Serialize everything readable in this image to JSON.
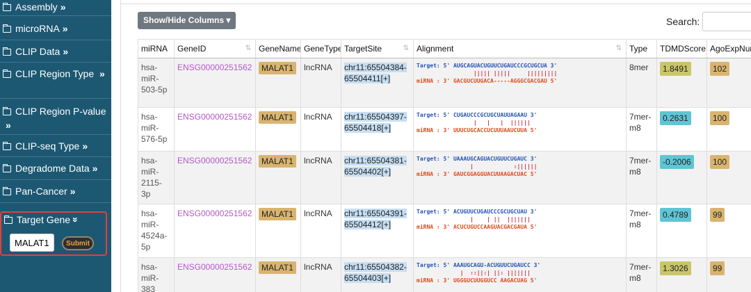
{
  "sidebar": {
    "items": [
      {
        "label": "Assembly",
        "chev": "»"
      },
      {
        "label": "microRNA",
        "chev": "»"
      },
      {
        "label": "CLIP Data",
        "chev": "»"
      },
      {
        "label": "CLIP Region Type",
        "chev": "»"
      },
      {
        "label": "CLIP Region P-value",
        "chev": "»"
      },
      {
        "label": "CLIP-seq Type",
        "chev": "»"
      },
      {
        "label": "Degradome Data",
        "chev": "»"
      },
      {
        "label": "Pan-Cancer",
        "chev": "»"
      }
    ],
    "target_gene": {
      "label": "Target Gene",
      "chev": "»",
      "input_value": "MALAT1",
      "submit_label": "Submit"
    }
  },
  "toolbar": {
    "show_hide_label": "Show/Hide Columns ▾",
    "search_label": "Search:"
  },
  "table": {
    "headers": [
      "miRNA",
      "GeneID",
      "GeneName",
      "GeneType",
      "TargetSite",
      "Alignment",
      "Type",
      "TDMDScore",
      "AgoExpNum"
    ],
    "rows": [
      {
        "mirna": "hsa-miR-503-5p",
        "gene_id": "ENSG00000251562",
        "gene_name": "MALAT1",
        "gene_type": "lncRNA",
        "site": "chr11:65504384-65504411[+]",
        "align_t": "Target: 5' AUGCAGUACUGUUCUGAUCCCGCUGCUA 3'",
        "align_b": "                 ||||| |||||     |||||||||",
        "align_m": "miRNA : 3' GACGUCUUGACA-----AGGGCGACGAU 5'",
        "type": "8mer",
        "tdmd": "1.8491",
        "tdmd_color": "olive",
        "ago": "102"
      },
      {
        "mirna": "hsa-miR-576-5p",
        "gene_id": "ENSG00000251562",
        "gene_name": "MALAT1",
        "gene_type": "lncRNA",
        "site": "chr11:65504397-65504418[+]",
        "align_t": "Target: 5' CUGAUCCCGCUGCUAUUAGAAU 3'",
        "align_b": "                 |   |   |  ||||||",
        "align_m": "miRNA : 3' UUUCUGCACCUCUUUAAUCUUA 5'",
        "type": "7mer-m8",
        "tdmd": "0.2631",
        "tdmd_color": "cyan",
        "ago": "100"
      },
      {
        "mirna": "hsa-miR-2115-3p",
        "gene_id": "ENSG00000251562",
        "gene_name": "MALAT1",
        "gene_type": "lncRNA",
        "site": "chr11:65504381-65504402[+]",
        "align_t": "Target: 5' UAAAUGCAGUACUGUUCUGAUC 3'",
        "align_b": "                |            :||||||",
        "align_m": "miRNA : 3' GAUCGGAGGUACUUAAGACUAC 5'",
        "type": "7mer-m8",
        "tdmd": "-0.2006",
        "tdmd_color": "cyan",
        "ago": "100"
      },
      {
        "mirna": "hsa-miR-4524a-5p",
        "gene_id": "ENSG00000251562",
        "gene_name": "MALAT1",
        "gene_type": "lncRNA",
        "site": "chr11:65504391-65504412[+]",
        "align_t": "Target: 5' ACUGUUCUGAUCCCGCUGCUAU 3'",
        "align_b": "                |    | ||  |||||||",
        "align_m": "miRNA : 3' ACUCUGUCCAAGUACGACGAUA 5'",
        "type": "7mer-m8",
        "tdmd": "0.4789",
        "tdmd_color": "cyan",
        "ago": "99"
      },
      {
        "mirna": "hsa-miR-383",
        "gene_id": "ENSG00000251562",
        "gene_name": "MALAT1",
        "gene_type": "lncRNA",
        "site": "chr11:65504382-65504403[+]",
        "align_t": "Target: 5' AAAUGCAGU-ACUGUUCUGAUCC 3'",
        "align_b": "             |  ::||:| ||: |||||||",
        "align_m": "miRNA : 3' UGGGUCUUGGUCC AAGACUAG 5'",
        "type": "7mer-m8",
        "tdmd": "1.3026",
        "tdmd_color": "olive",
        "ago": "99"
      }
    ]
  }
}
